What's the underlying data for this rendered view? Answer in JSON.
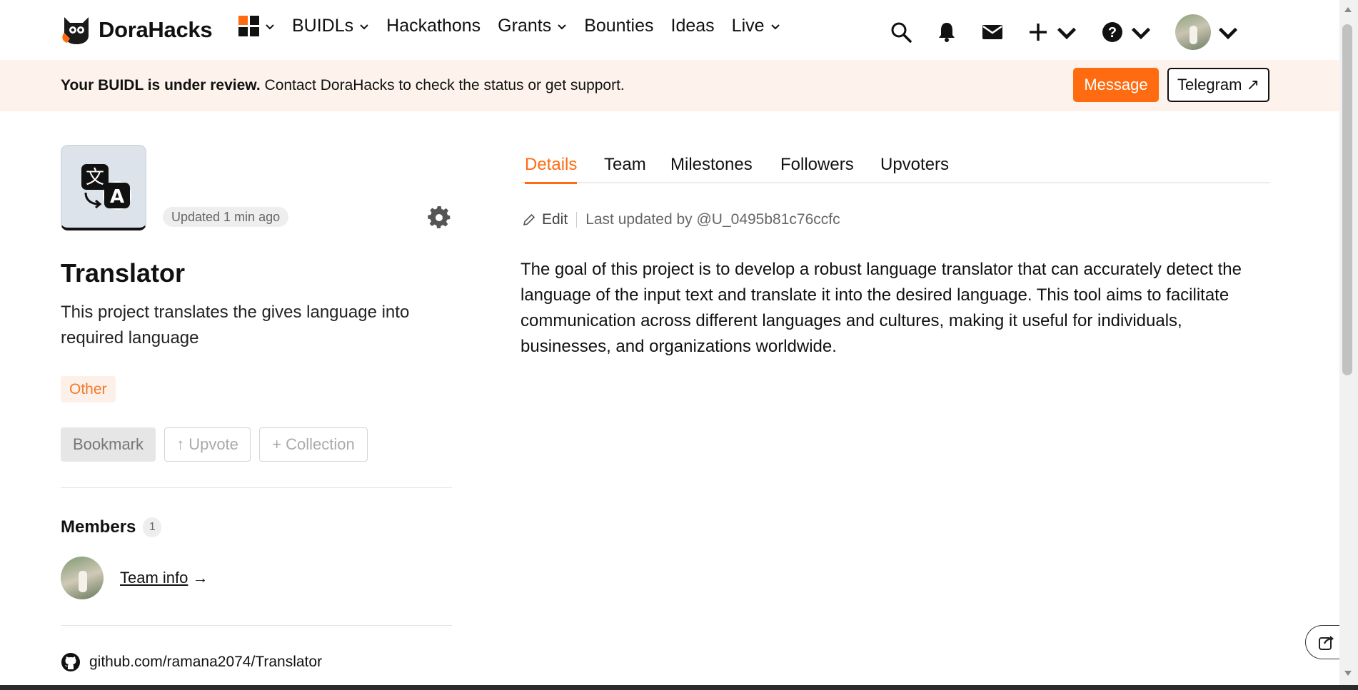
{
  "header": {
    "brand": "DoraHacks",
    "nav": [
      {
        "label": "BUIDLs",
        "has_dropdown": true
      },
      {
        "label": "Hackathons",
        "has_dropdown": false
      },
      {
        "label": "Grants",
        "has_dropdown": true
      },
      {
        "label": "Bounties",
        "has_dropdown": false
      },
      {
        "label": "Ideas",
        "has_dropdown": false
      },
      {
        "label": "Live",
        "has_dropdown": true
      }
    ],
    "icons": [
      "apps-grid-icon",
      "search-icon",
      "bell-icon",
      "mail-icon",
      "plus-icon",
      "help-icon",
      "avatar"
    ]
  },
  "banner": {
    "bold": "Your BUIDL is under review.",
    "text": " Contact DoraHacks to check the status or get support.",
    "message_label": "Message",
    "telegram_label": "Telegram ↗"
  },
  "project": {
    "updated": "Updated 1 min ago",
    "title": "Translator",
    "description": "This project translates the gives language into required language",
    "tag": "Other",
    "actions": {
      "bookmark": "Bookmark",
      "upvote": "↑ Upvote",
      "collection": "+ Collection"
    },
    "members_label": "Members",
    "members_count": "1",
    "team_link": "Team info",
    "team_arrow": "→",
    "github": "github.com/ramana2074/Translator"
  },
  "tabs": [
    {
      "label": "Details",
      "active": true
    },
    {
      "label": "Team",
      "active": false
    },
    {
      "label": "Milestones",
      "active": false
    },
    {
      "label": "Followers",
      "active": false
    },
    {
      "label": "Upvoters",
      "active": false
    }
  ],
  "details": {
    "edit_label": "Edit",
    "last_updated": "Last updated by @U_0495b81c76ccfc",
    "body": "The goal of this project is to develop a robust language translator that can accurately detect the language of the input text and translate it into the desired language. This tool aims to facilitate communication across different languages and cultures, making it useful for individuals, businesses, and organizations worldwide."
  },
  "colors": {
    "accent": "#ff6b10",
    "banner_bg": "#fdf3ec",
    "tag_bg": "#fdf0e8",
    "tag_text": "#f07b2a"
  }
}
